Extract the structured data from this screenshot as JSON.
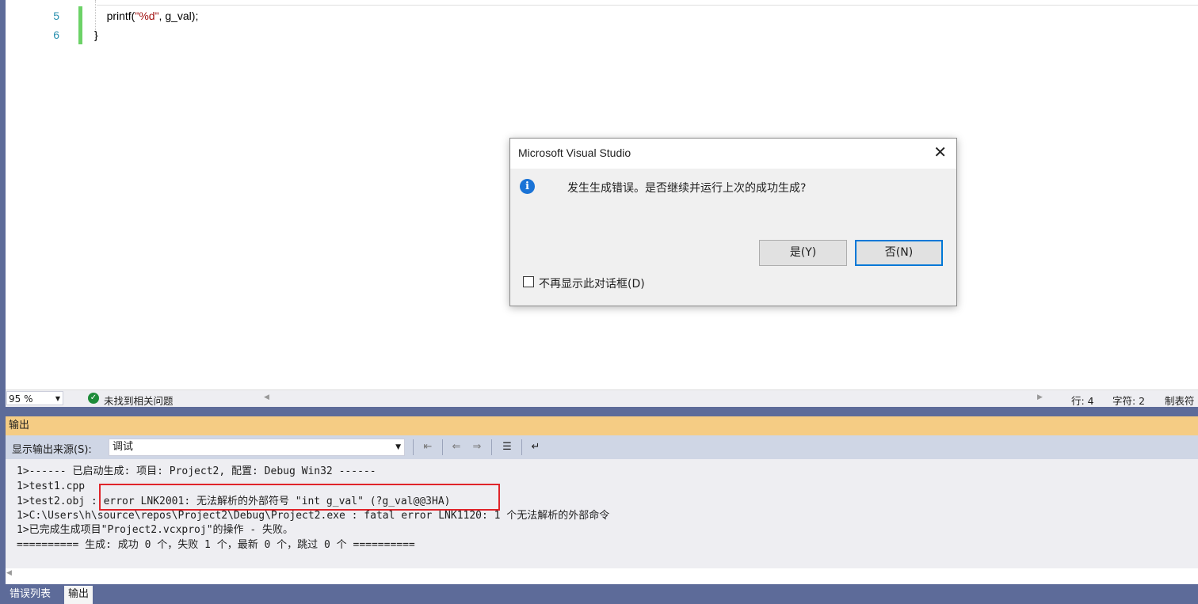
{
  "editor": {
    "lines": [
      {
        "num": "5",
        "indent": "    ",
        "code_pre": "printf(",
        "code_str": "\"%d\"",
        "code_post": ", g_val);"
      },
      {
        "num": "6",
        "indent": "",
        "code_pre": "}",
        "code_str": "",
        "code_post": ""
      }
    ]
  },
  "status_bar": {
    "zoom": "95 %",
    "message": "未找到相关问题",
    "line": "行: 4",
    "char": "字符: 2",
    "tab": "制表符"
  },
  "output": {
    "title": "输出",
    "source_label": "显示输出来源(S):",
    "source_value": "调试",
    "lines": [
      "1>------ 已启动生成: 项目: Project2, 配置: Debug Win32 ------",
      "1>test1.cpp",
      "1>test2.obj : error LNK2001: 无法解析的外部符号 \"int g_val\" (?g_val@@3HA)",
      "1>C:\\Users\\h\\source\\repos\\Project2\\Debug\\Project2.exe : fatal error LNK1120: 1 个无法解析的外部命令",
      "1>已完成生成项目\"Project2.vcxproj\"的操作 - 失败。",
      "========== 生成: 成功 0 个，失败 1 个，最新 0 个，跳过 0 个 =========="
    ]
  },
  "bottom_tabs": [
    {
      "label": "错误列表"
    },
    {
      "label": "输出"
    }
  ],
  "dialog": {
    "title": "Microsoft Visual Studio",
    "message": "发生生成错误。是否继续并运行上次的成功生成?",
    "yes_label": "是(Y)",
    "no_label": "否(N)",
    "checkbox_label": "不再显示此对话框(D)"
  },
  "icons": {
    "info": "info-icon",
    "close": "close-icon",
    "ok": "check-circle-icon"
  },
  "colors": {
    "accent": "#5d6b99",
    "output_title": "#f5cc84",
    "error_box": "#e0242a",
    "change_marker": "#6cd267",
    "dialog_default_border": "#0078d7"
  }
}
